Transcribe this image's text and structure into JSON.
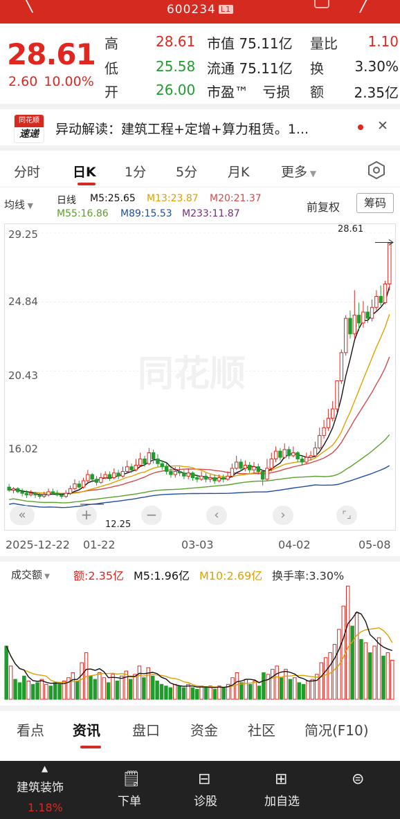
{
  "header": {
    "code": "600234",
    "level_badge": "L1"
  },
  "quote": {
    "price": "28.61",
    "change": "2.60",
    "change_pct": "10.00%",
    "high_label": "高",
    "high": "28.61",
    "low_label": "低",
    "low": "25.58",
    "open_label": "开",
    "open": "26.00",
    "mcap_label": "市值",
    "mcap": "75.11亿",
    "float_label": "流通",
    "float": "75.11亿",
    "pe_label": "市盈™",
    "pe": "亏损",
    "vol_ratio_label": "量比",
    "vol_ratio": "1.10",
    "turnover_label": "换",
    "turnover": "3.30%",
    "amount_label": "额",
    "amount": "2.35亿"
  },
  "news": {
    "logo_top": "同花顺",
    "logo_bottom": "速递",
    "text": "异动解读：建筑工程+定增+算力租赁。1..."
  },
  "period_tabs": [
    "分时",
    "日K",
    "1分",
    "5分",
    "月K",
    "更多"
  ],
  "active_period": "日K",
  "indicators": {
    "type_label": "均线",
    "period_label": "日线",
    "m5": "M5:25.65",
    "m13": "M13:23.87",
    "m20": "M20:21.37",
    "m55": "M55:16.86",
    "m89": "M89:15.53",
    "m233": "M233:11.87",
    "adjust_label": "前复权",
    "chips_label": "筹码"
  },
  "colors": {
    "up": "#e0261f",
    "down": "#1f9d2c",
    "m5": "#111111",
    "m13": "#e0a000",
    "m20": "#d44a4a",
    "m55": "#5aa02c",
    "m89": "#1f4fa0",
    "m233": "#7a2a80"
  },
  "chart_data": {
    "type": "candlestick",
    "y_ticks": [
      "29.25",
      "24.84",
      "20.43",
      "16.02"
    ],
    "x_ticks": [
      "2025-12-22",
      "01-22",
      "03-03",
      "04-02",
      "05-08"
    ],
    "ylim": [
      11.5,
      29.25
    ],
    "max_label": "28.61",
    "min_label": "12.25",
    "candles": [
      [
        13.0,
        12.8,
        13.2,
        12.7
      ],
      [
        12.8,
        12.9,
        13.0,
        12.6
      ],
      [
        12.9,
        12.7,
        13.0,
        12.6
      ],
      [
        12.7,
        12.6,
        12.9,
        12.4
      ],
      [
        12.6,
        12.5,
        12.8,
        12.3
      ],
      [
        12.5,
        12.6,
        12.8,
        12.4
      ],
      [
        12.6,
        12.5,
        12.7,
        12.3
      ],
      [
        12.5,
        12.4,
        12.6,
        12.25
      ],
      [
        12.4,
        12.5,
        12.7,
        12.3
      ],
      [
        12.5,
        12.7,
        12.9,
        12.4
      ],
      [
        12.7,
        12.6,
        12.9,
        12.5
      ],
      [
        12.6,
        12.5,
        12.8,
        12.4
      ],
      [
        12.5,
        12.4,
        12.6,
        12.25
      ],
      [
        12.4,
        12.6,
        12.8,
        12.3
      ],
      [
        12.6,
        12.9,
        13.1,
        12.5
      ],
      [
        12.9,
        13.2,
        13.5,
        12.8
      ],
      [
        13.2,
        13.0,
        13.4,
        12.9
      ],
      [
        13.0,
        13.4,
        13.6,
        12.9
      ],
      [
        13.4,
        13.8,
        14.1,
        13.3
      ],
      [
        13.8,
        13.5,
        13.9,
        13.3
      ],
      [
        13.5,
        13.3,
        13.7,
        13.1
      ],
      [
        13.3,
        13.6,
        13.9,
        13.2
      ],
      [
        13.6,
        13.8,
        14.0,
        13.5
      ],
      [
        13.8,
        13.6,
        14.0,
        13.4
      ],
      [
        13.6,
        13.9,
        14.2,
        13.5
      ],
      [
        13.9,
        13.7,
        14.1,
        13.5
      ],
      [
        13.7,
        14.0,
        14.3,
        13.6
      ],
      [
        14.0,
        14.3,
        14.7,
        13.9
      ],
      [
        14.3,
        14.1,
        14.5,
        13.9
      ],
      [
        14.1,
        14.4,
        14.8,
        14.0
      ],
      [
        14.4,
        14.8,
        15.2,
        14.3
      ],
      [
        14.8,
        14.5,
        15.0,
        14.3
      ],
      [
        14.5,
        15.2,
        15.5,
        14.4
      ],
      [
        15.2,
        14.8,
        15.4,
        14.5
      ],
      [
        14.8,
        14.5,
        15.1,
        14.3
      ],
      [
        14.5,
        14.3,
        14.7,
        14.1
      ],
      [
        14.3,
        14.0,
        14.5,
        13.8
      ],
      [
        14.0,
        13.8,
        14.2,
        13.6
      ],
      [
        13.8,
        14.0,
        14.3,
        13.6
      ],
      [
        14.0,
        13.9,
        14.3,
        13.7
      ],
      [
        13.9,
        13.7,
        14.1,
        13.5
      ],
      [
        13.7,
        13.9,
        14.2,
        13.5
      ],
      [
        13.9,
        13.6,
        14.0,
        13.4
      ],
      [
        13.6,
        13.5,
        13.8,
        13.3
      ],
      [
        13.5,
        13.7,
        14.0,
        13.4
      ],
      [
        13.7,
        13.5,
        13.9,
        13.3
      ],
      [
        13.5,
        13.6,
        13.8,
        13.3
      ],
      [
        13.6,
        13.4,
        13.8,
        13.2
      ],
      [
        13.4,
        13.6,
        13.8,
        13.3
      ],
      [
        13.6,
        13.5,
        13.8,
        13.3
      ],
      [
        13.5,
        13.7,
        14.0,
        13.4
      ],
      [
        13.7,
        14.2,
        14.5,
        13.6
      ],
      [
        14.2,
        14.6,
        15.0,
        14.1
      ],
      [
        14.6,
        14.2,
        14.8,
        14.0
      ],
      [
        14.2,
        14.4,
        14.7,
        14.0
      ],
      [
        14.4,
        14.1,
        14.6,
        13.9
      ],
      [
        14.1,
        14.3,
        14.6,
        13.9
      ],
      [
        14.3,
        14.0,
        14.5,
        13.8
      ],
      [
        14.0,
        13.5,
        14.1,
        13.1
      ],
      [
        13.5,
        14.2,
        14.8,
        13.4
      ],
      [
        14.2,
        14.8,
        15.2,
        14.0
      ],
      [
        14.8,
        15.3,
        15.6,
        14.6
      ],
      [
        15.3,
        14.9,
        15.5,
        14.7
      ],
      [
        14.9,
        15.4,
        15.8,
        14.8
      ],
      [
        15.4,
        15.0,
        15.6,
        14.8
      ],
      [
        15.0,
        15.2,
        15.6,
        14.9
      ],
      [
        15.2,
        14.8,
        15.3,
        14.6
      ],
      [
        14.8,
        14.6,
        15.0,
        14.4
      ],
      [
        14.6,
        14.9,
        15.2,
        14.5
      ],
      [
        14.9,
        15.0,
        15.3,
        14.7
      ],
      [
        15.0,
        15.5,
        15.9,
        14.9
      ],
      [
        15.5,
        16.3,
        16.8,
        15.4
      ],
      [
        16.3,
        16.8,
        17.3,
        16.1
      ],
      [
        16.8,
        17.4,
        18.0,
        16.6
      ],
      [
        17.4,
        18.0,
        18.5,
        17.2
      ],
      [
        18.0,
        19.8,
        19.8,
        17.8
      ],
      [
        19.8,
        21.6,
        21.8,
        19.6
      ],
      [
        21.6,
        23.8,
        24.0,
        21.4
      ],
      [
        23.8,
        22.8,
        24.3,
        22.5
      ],
      [
        22.8,
        24.0,
        25.6,
        22.5
      ],
      [
        24.0,
        23.5,
        24.8,
        23.0
      ],
      [
        23.5,
        24.2,
        24.9,
        23.2
      ],
      [
        24.2,
        23.8,
        24.6,
        23.5
      ],
      [
        23.8,
        24.5,
        25.0,
        23.6
      ],
      [
        24.5,
        25.2,
        25.6,
        24.3
      ],
      [
        25.2,
        24.8,
        25.9,
        24.6
      ],
      [
        24.8,
        26.0,
        26.2,
        24.7
      ],
      [
        26.0,
        28.61,
        28.61,
        25.58
      ]
    ]
  },
  "volume": {
    "label": "成交额",
    "amount": "额:2.35亿",
    "m5": "M5:1.96亿",
    "m10": "M10:2.69亿",
    "turnover": "换手率:3.30%",
    "values": [
      3.2,
      2.0,
      1.2,
      1.0,
      1.4,
      1.1,
      0.9,
      1.0,
      1.2,
      0.9,
      0.8,
      1.0,
      0.9,
      1.1,
      1.3,
      1.6,
      1.1,
      2.2,
      2.8,
      1.4,
      1.2,
      1.6,
      1.3,
      1.0,
      1.5,
      1.1,
      1.4,
      1.7,
      1.2,
      1.5,
      2.0,
      1.3,
      1.9,
      1.4,
      1.1,
      0.9,
      0.8,
      0.7,
      0.9,
      0.8,
      0.7,
      0.9,
      0.7,
      0.6,
      0.8,
      0.7,
      0.8,
      0.6,
      0.8,
      0.7,
      0.9,
      1.3,
      1.6,
      1.0,
      1.2,
      0.9,
      1.1,
      0.8,
      1.6,
      1.5,
      1.8,
      2.0,
      1.3,
      1.8,
      1.2,
      1.3,
      1.0,
      0.9,
      1.1,
      1.2,
      1.5,
      2.2,
      2.5,
      2.8,
      3.3,
      4.2,
      5.6,
      6.8,
      4.4,
      5.2,
      3.6,
      3.4,
      2.8,
      3.2,
      3.7,
      2.6,
      2.8,
      2.35
    ]
  },
  "bottom_tabs": [
    "看点",
    "资讯",
    "盘口",
    "资金",
    "社区",
    "简况(F10)"
  ],
  "active_bottom_tab": "资讯",
  "nav": {
    "sector_label": "建筑装饰",
    "sector_pct": "1.18%",
    "order_label": "下单",
    "diag_label": "诊股",
    "add_label": "加自选"
  }
}
